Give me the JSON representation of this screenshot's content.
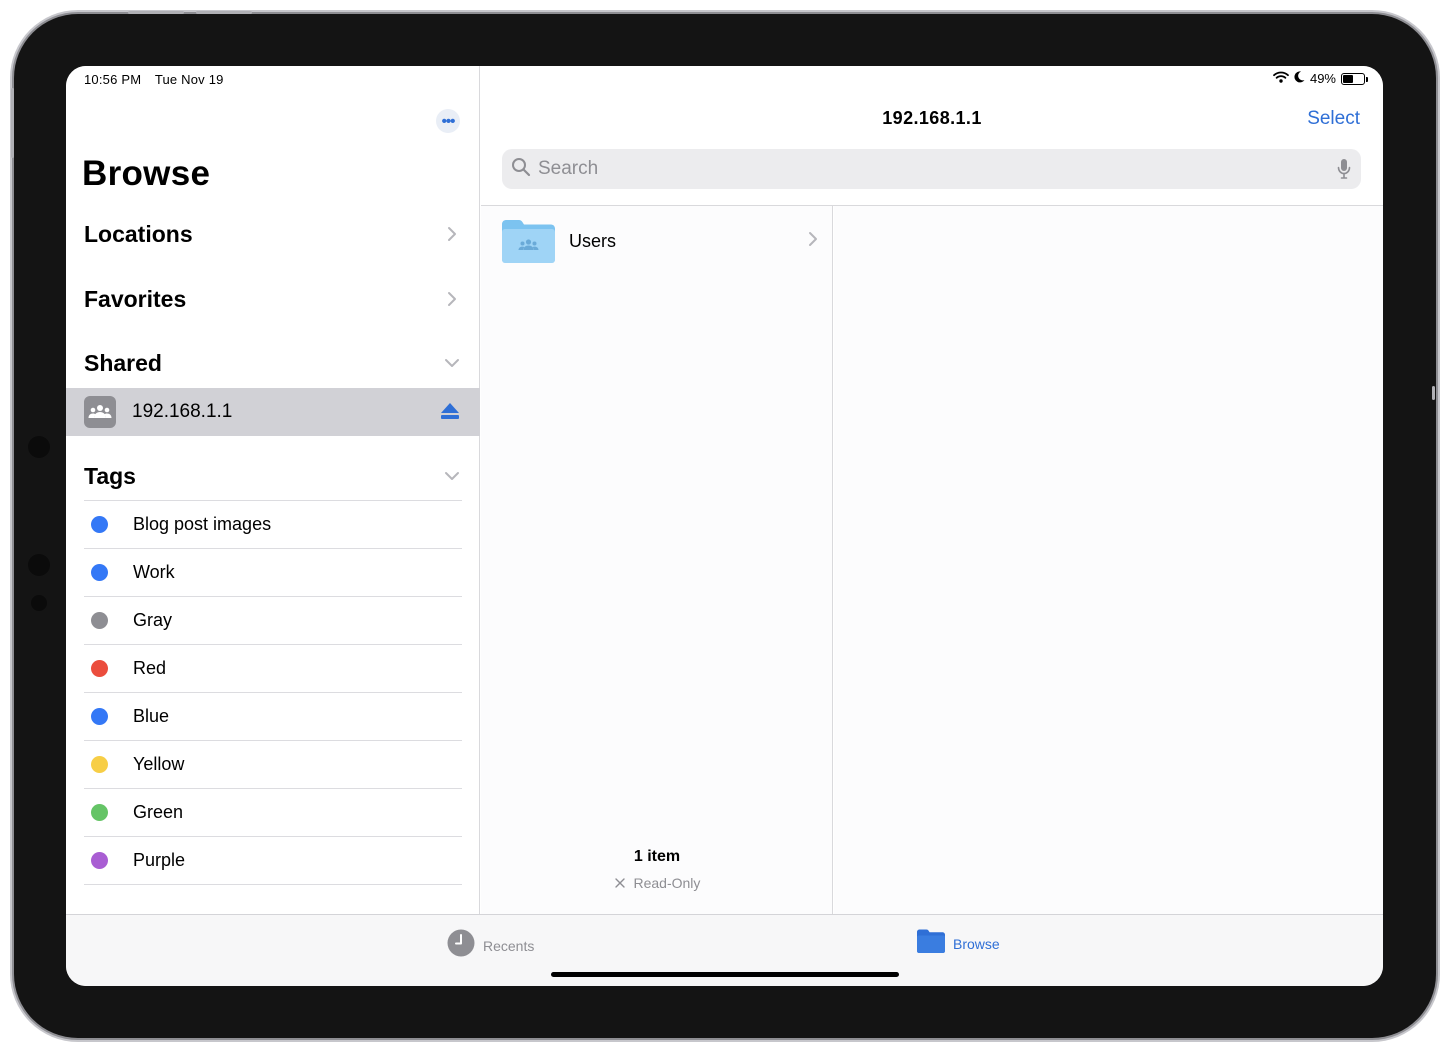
{
  "status_bar": {
    "time": "10:56 PM",
    "date": "Tue Nov 19",
    "battery_percent": "49%",
    "battery_level": 0.49,
    "icons": [
      "wifi-icon",
      "moon-icon",
      "battery-icon"
    ]
  },
  "sidebar": {
    "more_icon": "ellipsis-icon",
    "title": "Browse",
    "sections": [
      {
        "label": "Locations",
        "state": "collapsed"
      },
      {
        "label": "Favorites",
        "state": "collapsed"
      },
      {
        "label": "Shared",
        "state": "expanded"
      }
    ],
    "shared_items": [
      {
        "label": "192.168.1.1",
        "icon": "server-users-icon",
        "selected": true,
        "action_icon": "eject-icon"
      }
    ],
    "tags_header": {
      "label": "Tags",
      "state": "expanded"
    },
    "tags": [
      {
        "label": "Blog post images",
        "color": "#3478f6"
      },
      {
        "label": "Work",
        "color": "#3478f6"
      },
      {
        "label": "Gray",
        "color": "#8e8e93"
      },
      {
        "label": "Red",
        "color": "#eb4d3d"
      },
      {
        "label": "Blue",
        "color": "#3478f6"
      },
      {
        "label": "Yellow",
        "color": "#f7ce46"
      },
      {
        "label": "Green",
        "color": "#65c466"
      },
      {
        "label": "Purple",
        "color": "#a95ed3"
      }
    ]
  },
  "main": {
    "title": "192.168.1.1",
    "select_label": "Select",
    "search": {
      "placeholder": "Search",
      "icon": "search-icon",
      "mic_icon": "microphone-icon"
    },
    "items": [
      {
        "label": "Users",
        "icon": "shared-folder-icon"
      }
    ],
    "footer": {
      "count": "1 item",
      "access": "Read-Only"
    }
  },
  "tabbar": {
    "tabs": [
      {
        "label": "Recents",
        "icon": "clock-icon",
        "active": false
      },
      {
        "label": "Browse",
        "icon": "folder-icon",
        "active": true
      }
    ]
  },
  "colors": {
    "accent": "#2f6fd6",
    "selection_bg": "#d1d1d6",
    "folder_blue": "#8ecdf5",
    "separator": "#d9d9dc"
  }
}
